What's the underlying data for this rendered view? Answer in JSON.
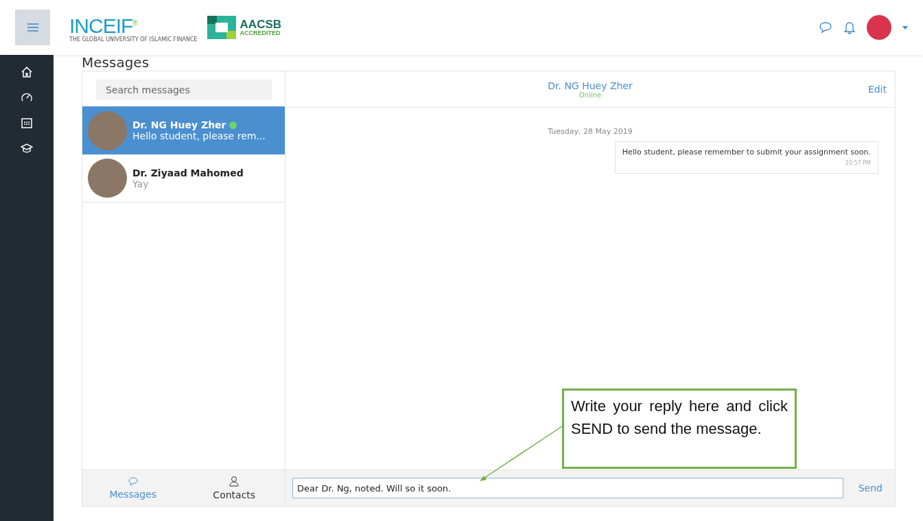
{
  "header": {
    "brand": "INCEIF",
    "brand_mark": "®",
    "brand_tagline": "THE GLOBAL UNIVERSITY OF ISLAMIC FINANCE",
    "accreditation": "AACSB",
    "accreditation_sub": "ACCREDITED"
  },
  "page_title": "Messages",
  "search": {
    "placeholder": "Search messages"
  },
  "conversations": [
    {
      "name": "Dr. NG Huey Zher",
      "preview": "Hello student, please rem...",
      "online": true,
      "selected": true
    },
    {
      "name": "Dr. Ziyaad Mahomed",
      "preview": "Yay",
      "online": false,
      "selected": false
    }
  ],
  "footer_tabs": [
    {
      "kind": "chat",
      "label": "Messages",
      "selected": true
    },
    {
      "kind": "contacts",
      "label": "Contacts",
      "selected": false
    }
  ],
  "chat": {
    "name": "Dr. NG Huey Zher",
    "status": "Online",
    "edit": "Edit",
    "date": "Tuesday, 28 May 2019",
    "messages": [
      {
        "text": "Hello student, please remember to submit your assignment soon.",
        "time": "10:57 PM"
      }
    ],
    "reply": "Dear Dr. Ng, noted. Will so it soon.",
    "send": "Send"
  },
  "callout": {
    "text": "Write your reply here and click SEND to send the message."
  }
}
